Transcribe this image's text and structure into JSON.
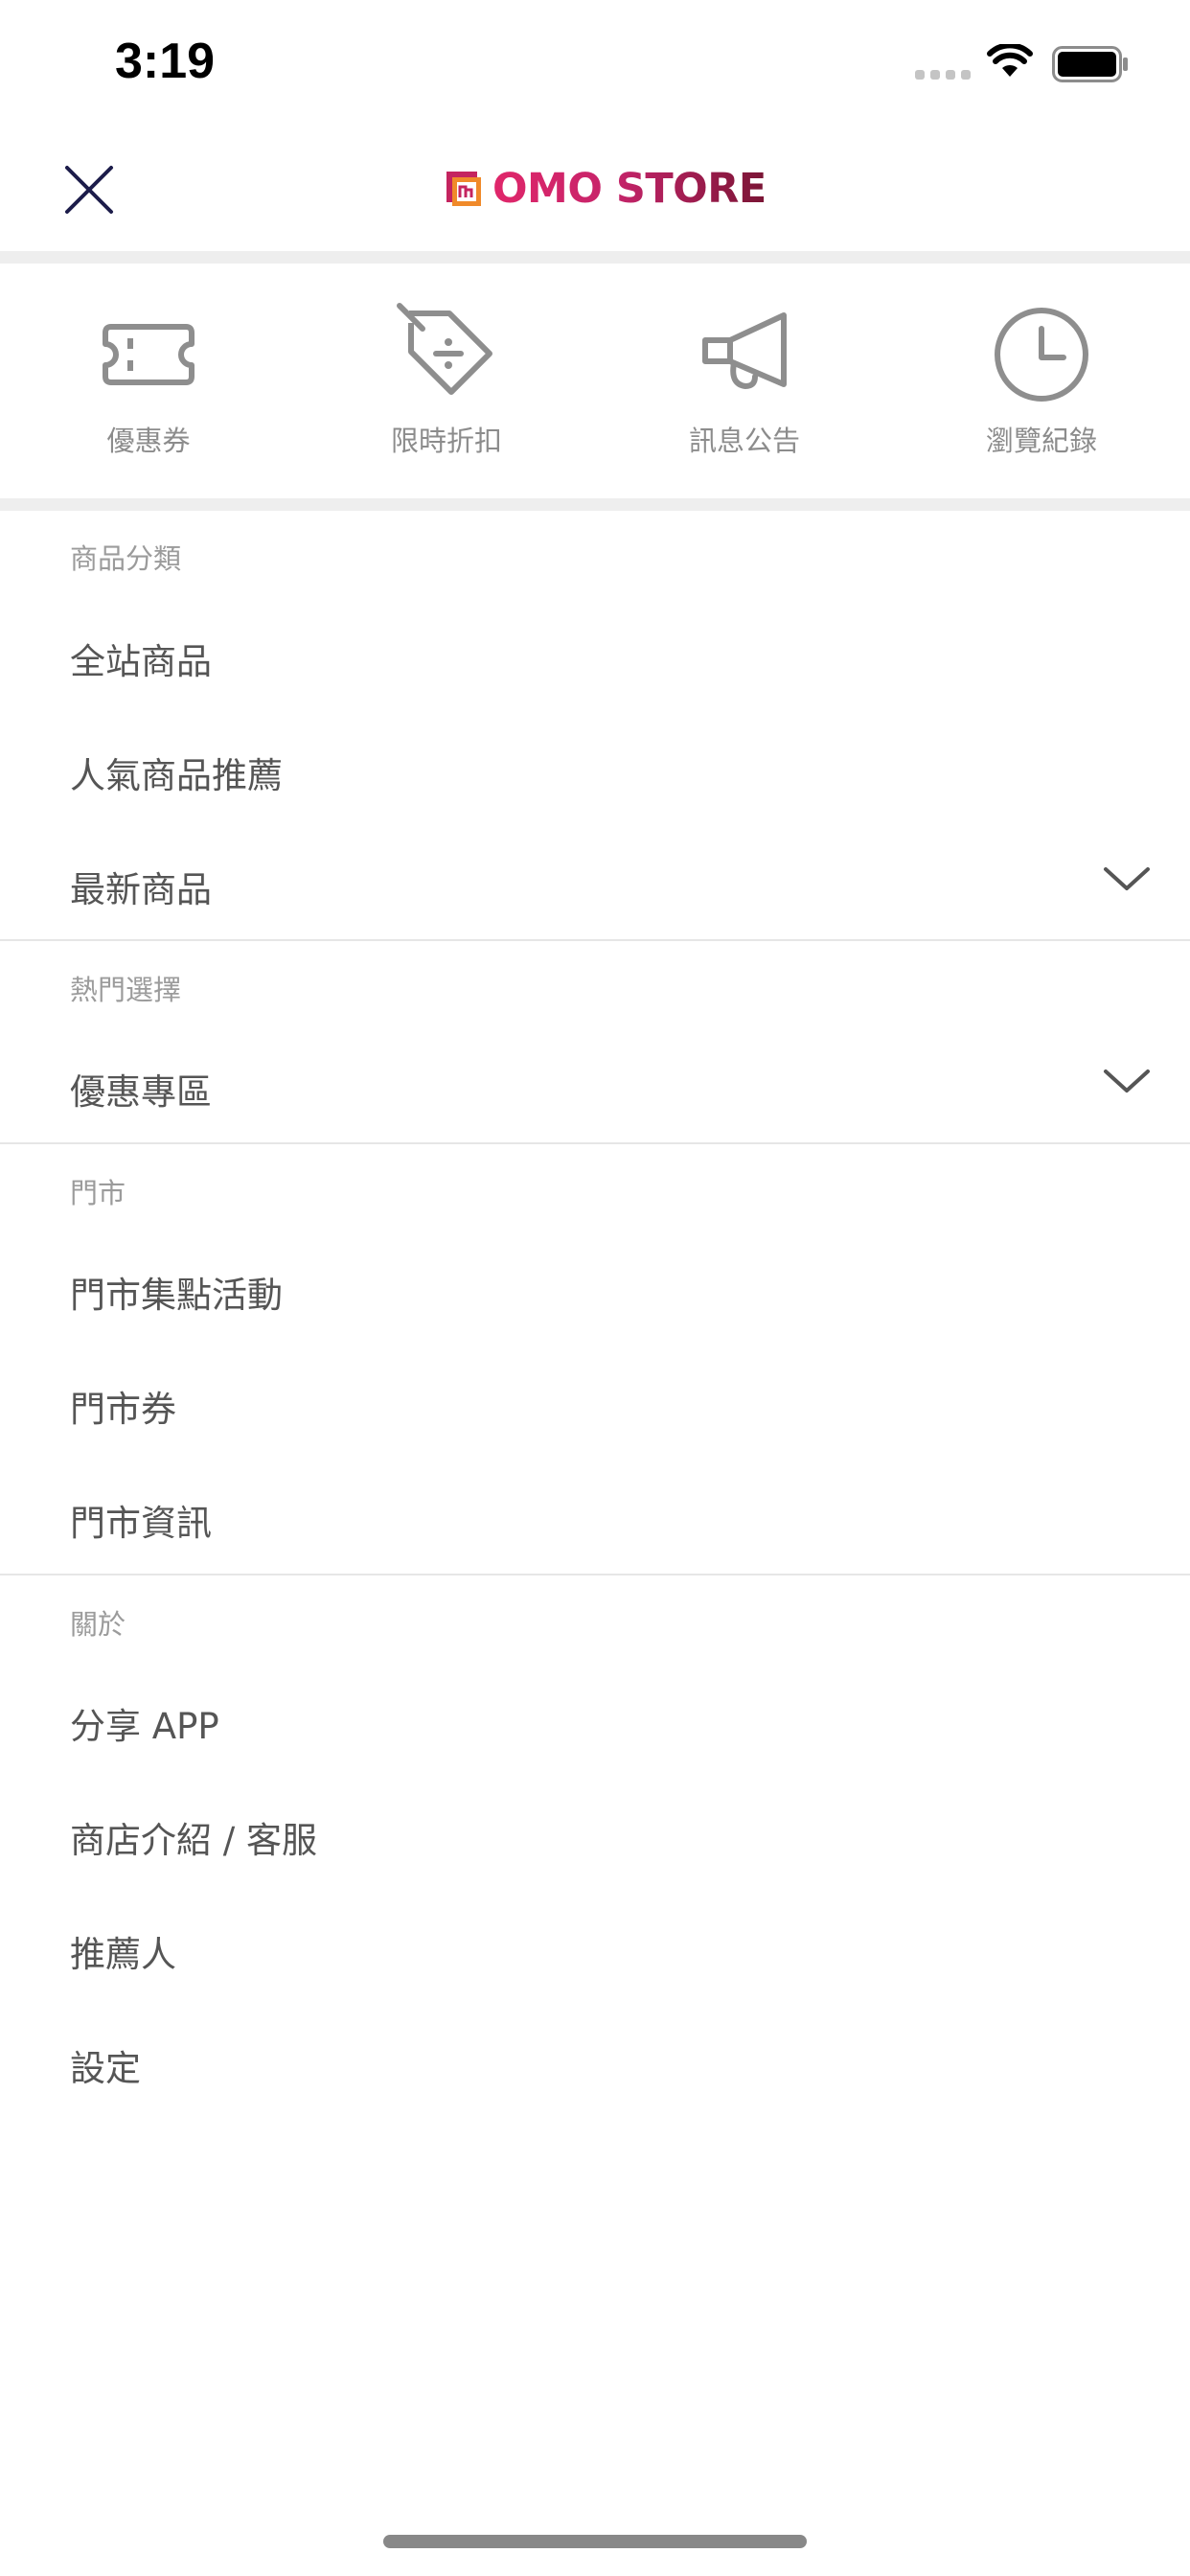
{
  "status_bar": {
    "time": "3:19"
  },
  "header": {
    "logo_text": "OMO STORE"
  },
  "quick_actions": [
    {
      "label": "優惠券",
      "icon": "ticket-icon"
    },
    {
      "label": "限時折扣",
      "icon": "discount-tag-icon"
    },
    {
      "label": "訊息公告",
      "icon": "megaphone-icon"
    },
    {
      "label": "瀏覽紀錄",
      "icon": "clock-icon"
    }
  ],
  "sections": {
    "categories": {
      "title": "商品分類",
      "items": [
        "全站商品",
        "人氣商品推薦",
        "最新商品"
      ]
    },
    "hot": {
      "title": "熱門選擇",
      "items": [
        "優惠專區"
      ]
    },
    "store": {
      "title": "門市",
      "items": [
        "門市集點活動",
        "門市券",
        "門市資訊"
      ]
    },
    "about": {
      "title": "關於",
      "items": [
        "分享 APP",
        "商店介紹 / 客服",
        "推薦人",
        "設定"
      ]
    }
  }
}
